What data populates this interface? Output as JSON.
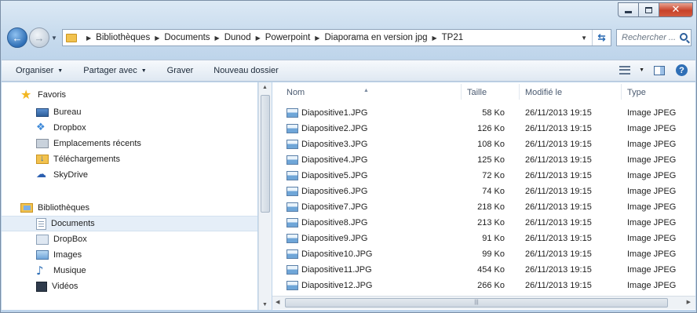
{
  "window": {
    "caption": {
      "minimize": "—",
      "maximize": "□",
      "close": "✕"
    }
  },
  "address": {
    "crumbs": [
      "Bibliothèques",
      "Documents",
      "Dunod",
      "Powerpoint",
      "Diaporama en version jpg",
      "TP21"
    ],
    "search_placeholder": "Rechercher ..."
  },
  "toolbar": {
    "organize": "Organiser",
    "share": "Partager avec",
    "burn": "Graver",
    "new_folder": "Nouveau dossier",
    "help": "?"
  },
  "nav": {
    "favorites_label": "Favoris",
    "favorites": [
      "Bureau",
      "Dropbox",
      "Emplacements récents",
      "Téléchargements",
      "SkyDrive"
    ],
    "libraries_label": "Bibliothèques",
    "libraries": [
      "Documents",
      "DropBox",
      "Images",
      "Musique",
      "Vidéos"
    ],
    "selected": "Documents"
  },
  "columns": {
    "name": "Nom",
    "size": "Taille",
    "modified": "Modifié le",
    "type": "Type"
  },
  "files": [
    {
      "name": "Diapositive1.JPG",
      "size": "58 Ko",
      "modified": "26/11/2013 19:15",
      "type": "Image JPEG"
    },
    {
      "name": "Diapositive2.JPG",
      "size": "126 Ko",
      "modified": "26/11/2013 19:15",
      "type": "Image JPEG"
    },
    {
      "name": "Diapositive3.JPG",
      "size": "108 Ko",
      "modified": "26/11/2013 19:15",
      "type": "Image JPEG"
    },
    {
      "name": "Diapositive4.JPG",
      "size": "125 Ko",
      "modified": "26/11/2013 19:15",
      "type": "Image JPEG"
    },
    {
      "name": "Diapositive5.JPG",
      "size": "72 Ko",
      "modified": "26/11/2013 19:15",
      "type": "Image JPEG"
    },
    {
      "name": "Diapositive6.JPG",
      "size": "74 Ko",
      "modified": "26/11/2013 19:15",
      "type": "Image JPEG"
    },
    {
      "name": "Diapositive7.JPG",
      "size": "218 Ko",
      "modified": "26/11/2013 19:15",
      "type": "Image JPEG"
    },
    {
      "name": "Diapositive8.JPG",
      "size": "213 Ko",
      "modified": "26/11/2013 19:15",
      "type": "Image JPEG"
    },
    {
      "name": "Diapositive9.JPG",
      "size": "91 Ko",
      "modified": "26/11/2013 19:15",
      "type": "Image JPEG"
    },
    {
      "name": "Diapositive10.JPG",
      "size": "99 Ko",
      "modified": "26/11/2013 19:15",
      "type": "Image JPEG"
    },
    {
      "name": "Diapositive11.JPG",
      "size": "454 Ko",
      "modified": "26/11/2013 19:15",
      "type": "Image JPEG"
    },
    {
      "name": "Diapositive12.JPG",
      "size": "266 Ko",
      "modified": "26/11/2013 19:15",
      "type": "Image JPEG"
    }
  ],
  "colors": {
    "accent": "#2f6fb6",
    "selection": "#e5eef8",
    "close": "#c8422a",
    "folder": "#f2c24e"
  },
  "icons": {
    "nav_favorites": "star-icon",
    "nav_favorite_items": [
      "desktop-icon",
      "dropbox-icon",
      "recent-places-icon",
      "downloads-icon",
      "skydrive-icon"
    ],
    "nav_libraries": "library-icon",
    "nav_library_items": [
      "documents-icon",
      "dropbox-folder-icon",
      "images-icon",
      "music-icon",
      "videos-icon"
    ],
    "file": "jpeg-file-icon"
  }
}
